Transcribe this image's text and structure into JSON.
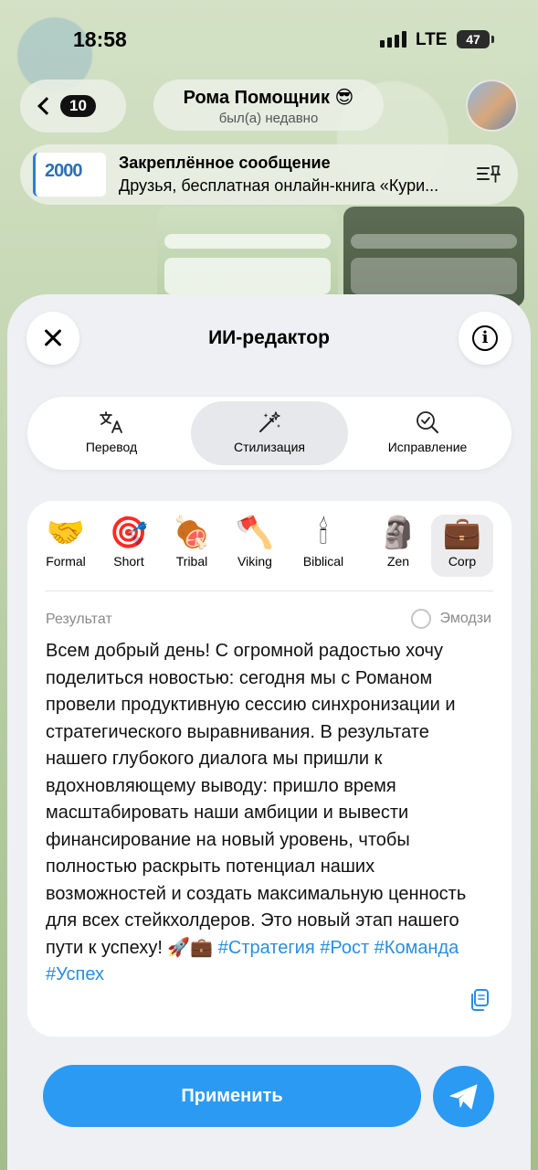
{
  "status_bar": {
    "time": "18:58",
    "network": "LTE",
    "battery": "47"
  },
  "chat": {
    "back_count": "10",
    "name": "Рома Помощник 😎",
    "status": "был(а) недавно"
  },
  "pinned": {
    "thumb_text": "2000",
    "title": "Закреплённое сообщение",
    "text": "Друзья, бесплатная онлайн-книга «Кури..."
  },
  "editor": {
    "title": "ИИ-редактор",
    "tabs": [
      {
        "label": "Перевод",
        "icon": "translate-icon"
      },
      {
        "label": "Стилизация",
        "icon": "magic-wand-icon"
      },
      {
        "label": "Исправление",
        "icon": "magnifier-check-icon"
      }
    ],
    "active_tab": "Стилизация",
    "styles": [
      {
        "emoji": "🤝",
        "label": "Formal"
      },
      {
        "emoji": "🎯",
        "label": "Short"
      },
      {
        "emoji": "🍖",
        "label": "Tribal"
      },
      {
        "emoji": "🪓",
        "label": "Viking"
      },
      {
        "emoji": "🕯",
        "label": "Biblical"
      },
      {
        "emoji": "🗿",
        "label": "Zen"
      },
      {
        "emoji": "💼",
        "label": "Corp"
      }
    ],
    "active_style": "Corp",
    "result_label": "Результат",
    "emoji_toggle_label": "Эмодзи",
    "result_text": "Всем добрый день! С огромной радостью хочу поделиться новостью: сегодня мы с Романом провели продуктивную сессию синхронизации и стратегического выравнивания. В результате нашего глубокого диалога мы пришли к вдохновляющему выводу: пришло время масштабировать наши амбиции и вывести финансирование на новый уровень, чтобы полностью раскрыть потенциал наших возможностей и создать максимальную ценность для всех стейкхолдеров. Это новый этап нашего пути к успеху! 🚀💼",
    "result_tags": "#Стратегия #Рост #Команда #Успех",
    "apply_label": "Применить"
  },
  "colors": {
    "accent": "#2b9af3",
    "tag": "#2a8ee0",
    "sheet_bg": "#eef0f3"
  }
}
